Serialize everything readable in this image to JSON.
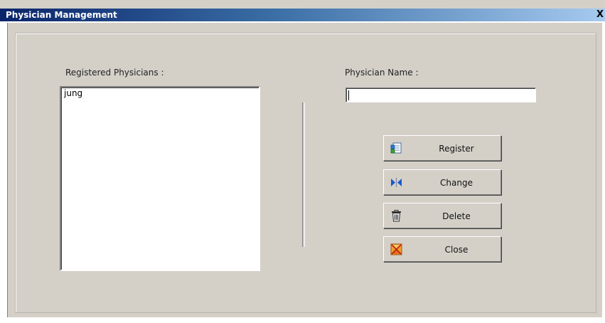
{
  "window": {
    "title": "Physician Management",
    "close_glyph": "X"
  },
  "list": {
    "label": "Registered Physicians :",
    "items": [
      "jung"
    ]
  },
  "name_field": {
    "label": "Physician Name :",
    "value": ""
  },
  "buttons": {
    "register": {
      "label": "Register",
      "icon": "register-icon"
    },
    "change": {
      "label": "Change",
      "icon": "change-icon"
    },
    "delete": {
      "label": "Delete",
      "icon": "trash-icon"
    },
    "close": {
      "label": "Close",
      "icon": "close-icon"
    }
  },
  "colors": {
    "titlebar_start": "#0a246a",
    "titlebar_end": "#a6caf0",
    "panel": "#d4d0c8"
  }
}
